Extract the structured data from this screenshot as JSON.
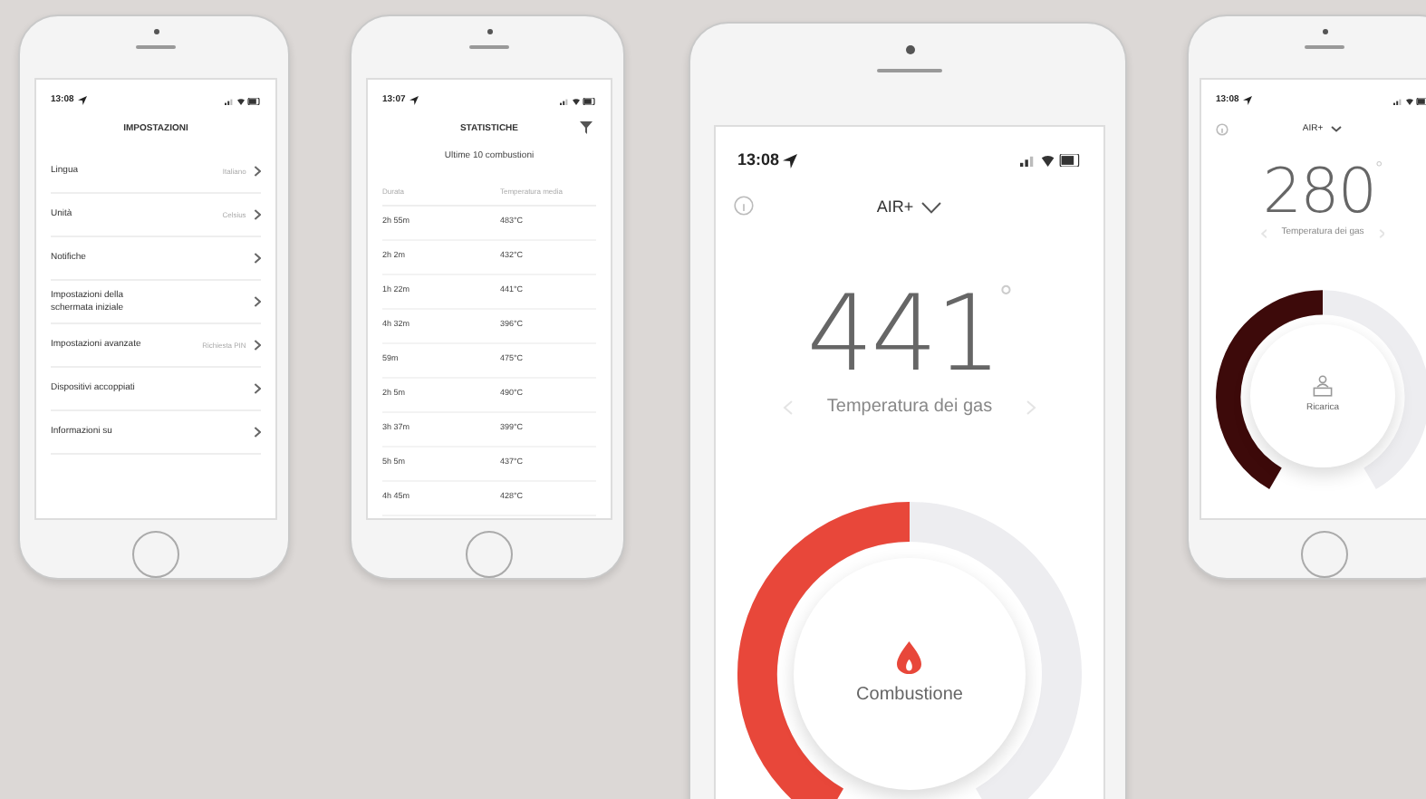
{
  "phones": [
    {
      "kind": "settings",
      "status_time": "13:08",
      "title": "IMPOSTAZIONI",
      "items": [
        {
          "label": "Lingua",
          "value": "Italiano"
        },
        {
          "label": "Unità",
          "value": "Celsius"
        },
        {
          "label": "Notifiche"
        },
        {
          "label": "Impostazioni della schermata iniziale"
        },
        {
          "label": "Impostazioni avanzate",
          "value": "Richiesta PIN"
        },
        {
          "label": "Dispositivi accoppiati"
        },
        {
          "label": "Informazioni su"
        }
      ]
    },
    {
      "kind": "statistics",
      "status_time": "13:07",
      "title": "STATISTICHE",
      "subtitle": "Ultime 10 combustioni",
      "columns": [
        "Durata",
        "Temperatura media"
      ],
      "rows": [
        [
          "2h 55m",
          "483°C"
        ],
        [
          "2h 2m",
          "432°C"
        ],
        [
          "1h 22m",
          "441°C"
        ],
        [
          "4h 32m",
          "396°C"
        ],
        [
          "59m",
          "475°C"
        ],
        [
          "2h 5m",
          "490°C"
        ],
        [
          "3h 37m",
          "399°C"
        ],
        [
          "5h 5m",
          "437°C"
        ],
        [
          "4h 45m",
          "428°C"
        ]
      ]
    },
    {
      "kind": "gauge",
      "status_time": "13:08",
      "device": "AIR+",
      "temperature": "441",
      "unit": "°",
      "temperature_label": "Temperatura dei gas",
      "mode": {
        "kind": "combustion",
        "label": "Combustione"
      },
      "level": 0.5,
      "color": "#e8473a"
    },
    {
      "kind": "gauge",
      "status_time": "13:08",
      "device": "AIR+",
      "temperature": "280",
      "unit": "°",
      "temperature_label": "Temperatura dei gas",
      "mode": {
        "kind": "recharge",
        "label": "Ricarica"
      },
      "level": 0.5,
      "color": "#3d0a0a"
    }
  ]
}
